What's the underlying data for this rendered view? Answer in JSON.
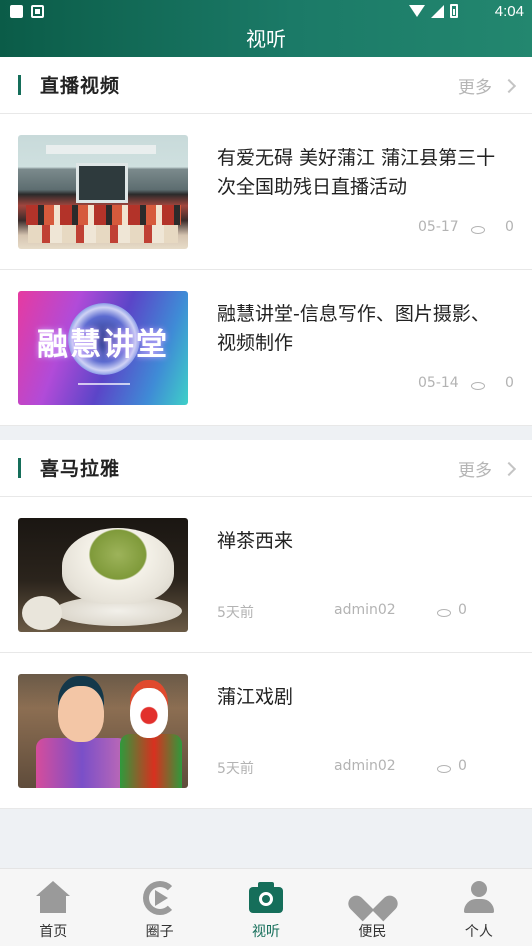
{
  "status_bar": {
    "time": "4:04"
  },
  "header": {
    "title": "视听"
  },
  "live_section": {
    "title": "直播视频",
    "more_label": "更多",
    "items": [
      {
        "title": "有爱无碍 美好蒲江 蒲江县第三十次全国助残日直播活动",
        "date": "05-17",
        "views": "0"
      },
      {
        "title": "融慧讲堂-信息写作、图片摄影、视频制作",
        "date": "05-14",
        "views": "0",
        "thumb_text": "融慧讲堂"
      }
    ]
  },
  "himalaya_section": {
    "title": "喜马拉雅",
    "more_label": "更多",
    "items": [
      {
        "title": "禅茶西来",
        "time": "5天前",
        "author": "admin02",
        "views": "0"
      },
      {
        "title": "蒲江戏剧",
        "time": "5天前",
        "author": "admin02",
        "views": "0"
      }
    ]
  },
  "bottom_nav": {
    "tabs": [
      {
        "label": "首页",
        "icon": "home-icon"
      },
      {
        "label": "圈子",
        "icon": "circle-play-icon"
      },
      {
        "label": "视听",
        "icon": "camera-icon",
        "active": true
      },
      {
        "label": "便民",
        "icon": "heart-icon"
      },
      {
        "label": "个人",
        "icon": "person-icon"
      }
    ],
    "active_color": "#156e5a"
  }
}
